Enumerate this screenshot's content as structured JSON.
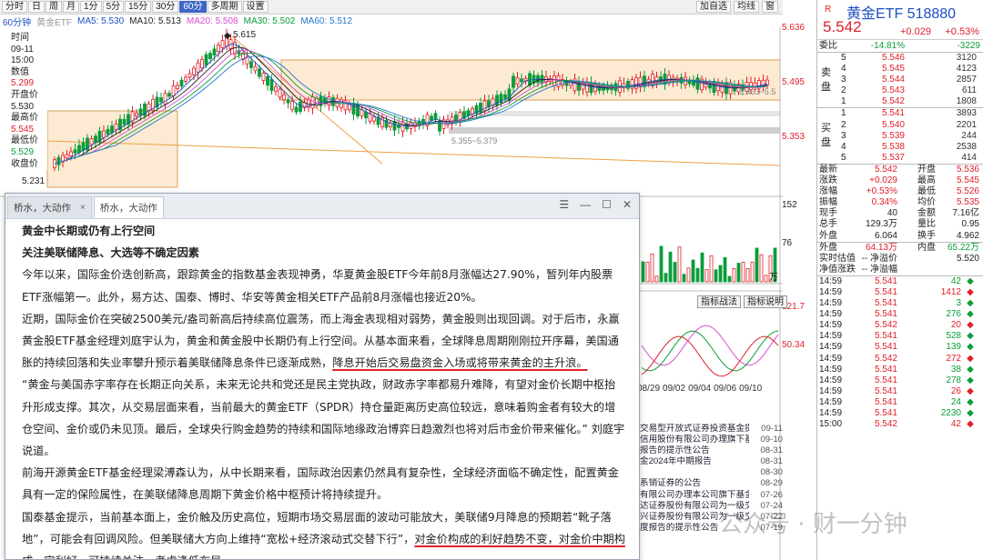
{
  "toolbar": {
    "buttons": [
      "分时",
      "日",
      "周",
      "月",
      "1分",
      "5分",
      "15分",
      "30分",
      "60分",
      "多周期",
      "设置"
    ],
    "active_index": 8,
    "right_buttons": [
      "加自选",
      "均线",
      "窗"
    ]
  },
  "ma_row": {
    "period": "60分钟",
    "name": "黄金ETF",
    "ma5": "MA5: 5.530",
    "ma10": "MA10: 5.513",
    "ma20": "MA20: 5.508",
    "ma30": "MA30: 5.502",
    "ma60": "MA60: 5.512",
    "colors": {
      "ma5": "#1f4fc4",
      "ma10": "#222222",
      "ma20": "#d74fd0",
      "ma30": "#0b9d3a",
      "ma60": "#2277cc"
    }
  },
  "left_panel": {
    "time_label": "时间",
    "date": "09-11",
    "time": "15:00",
    "value_label": "数值",
    "value": "5.299",
    "open_label": "开盘价",
    "open": "5.530",
    "high_label": "最高价",
    "high": "5.545",
    "low_label": "最低价",
    "low": "5.529",
    "close_label": "收盘价"
  },
  "price_labels": {
    "p1": "5.636",
    "p2": "5.495",
    "p3": "5.353",
    "hi_mark": "5.615",
    "lo_mark": "5.231",
    "range_mark": "5.355~5.379",
    "range_mark2": "5.463~5.5"
  },
  "volume_labels": {
    "v1": "152",
    "v2": "76",
    "unit": "万"
  },
  "indicator": {
    "tab1": "指标战法",
    "tab2": "指标说明",
    "v1": "121.7",
    "v2": "50.34"
  },
  "dates": [
    "08/29",
    "09/02",
    "09/04",
    "09/06",
    "09/10"
  ],
  "news_list": [
    {
      "title": "交易型开放式证券投资基金提供主...",
      "date": "09-11"
    },
    {
      "title": "信用股份有限公司办理旗下基金相关销...",
      "date": "09-10"
    },
    {
      "title": "报告的提示性公告",
      "date": "08-31"
    },
    {
      "title": "金2024年中期报告",
      "date": "08-31"
    },
    {
      "title": "",
      "date": "08-30"
    },
    {
      "title": "系销证券的公告",
      "date": "08-29"
    },
    {
      "title": "有限公司办理本公司旗下基金...",
      "date": "07-26"
    },
    {
      "title": "达证券股份有限公司为一级交易商...",
      "date": "07-24"
    },
    {
      "title": "兴证券股份有限公司为一级交易商...",
      "date": "07-22"
    },
    {
      "title": "度报告的提示性公告",
      "date": "07-19"
    }
  ],
  "news": {
    "tabs": [
      "桥水，大动作",
      "桥水，大动作"
    ],
    "heading1": "黄金中长期或仍有上行空间",
    "heading2": "关注美联储降息、大选等不确定因素",
    "p1": "今年以来，国际金价迭创新高，跟踪黄金的指数基金表现神勇，华夏黄金股ETF今年前8月涨幅达27.90%，暂列年内股票ETF涨幅第一。此外，易方达、国泰、博时、华安等黄金相关ETF产品前8月涨幅也接近20%。",
    "p2a": "近期，国际金价在突破2500美元/盎司新高后持续高位震荡，而上海金表现相对弱势，黄金股则出现回调。对于后市，永赢黄金股ETF基金经理刘庭宇认为，黄金和黄金股中长期仍有上行空间。从基本面来看，全球降息周期刚刚拉开序幕，美国通胀的持续回落和失业率攀升预示着美联储降息条件已逐渐成熟，",
    "p2b": "降息开始后交易盘资金入场或将带来黄金的主升浪。",
    "p3": "“黄金与美国赤字率存在长期正向关系，未来无论共和党还是民主党执政，财政赤字率都易升难降，有望对金价长期中枢抬升形成支撑。其次，从交易层面来看，当前最大的黄金ETF（SPDR）持仓量距离历史高位较远，意味着购金者有较大的增仓空间、金价或仍未见顶。最后，全球央行购金趋势的持续和国际地缘政治博弈日趋激烈也将对后市金价带来催化。” 刘庭宇说道。",
    "p4": "前海开源黄金ETF基金经理梁溥森认为，从中长期来看，国际政治因素仍然具有复杂性，全球经济面临不确定性，配置黄金具有一定的保险属性，在美联储降息周期下黄金价格中枢预计将持续提升。",
    "p5a": "国泰基金提示，当前基本面上，金价触及历史高位，短期市场交易层面的波动可能放大，美联储9月降息的预期若“靴子落地”，可能会有回调风险。但美联储大方向上维持“宽松+经济滚动式交替下行”，",
    "p5b": "对金价构成的利好趋势不变，对金价中期构成一定利好，可持续关注、考虑逢低布局。"
  },
  "quote": {
    "R": "R",
    "name": "黄金ETF 518880",
    "price": "5.542",
    "change": "+0.029",
    "pct": "+0.53%",
    "wb_label": "委比",
    "wb": "-14.81%",
    "wc": "-3229",
    "sell_label": "卖盘",
    "buy_label": "买盘",
    "asks": [
      {
        "lv": "5",
        "price": "5.546",
        "vol": "3120"
      },
      {
        "lv": "4",
        "price": "5.545",
        "vol": "4123"
      },
      {
        "lv": "3",
        "price": "5.544",
        "vol": "2857"
      },
      {
        "lv": "2",
        "price": "5.543",
        "vol": "611"
      },
      {
        "lv": "1",
        "price": "5.542",
        "vol": "1808"
      }
    ],
    "bids": [
      {
        "lv": "1",
        "price": "5.541",
        "vol": "3893"
      },
      {
        "lv": "2",
        "price": "5.540",
        "vol": "2201"
      },
      {
        "lv": "3",
        "price": "5.539",
        "vol": "244"
      },
      {
        "lv": "4",
        "price": "5.538",
        "vol": "2538"
      },
      {
        "lv": "5",
        "price": "5.537",
        "vol": "414"
      }
    ],
    "stats": [
      [
        "最新",
        "5.542",
        "开盘",
        "5.536"
      ],
      [
        "涨跌",
        "+0.029",
        "最高",
        "5.545"
      ],
      [
        "涨幅",
        "+0.53%",
        "最低",
        "5.526"
      ],
      [
        "振幅",
        "0.34%",
        "均价",
        "5.535"
      ],
      [
        "现手",
        "40",
        "金额",
        "7.16亿"
      ],
      [
        "总手",
        "129.3万",
        "量比",
        "0.95"
      ],
      [
        "外盘",
        "6.064",
        "换手",
        "4.962"
      ]
    ],
    "outer": [
      "外盘",
      "64.13万",
      "内盘",
      "65.22万"
    ],
    "extra": [
      [
        "实时估值",
        "-- 净溢价",
        "",
        "5.520"
      ],
      [
        "净值涨跌",
        "-- 净溢幅",
        "",
        ""
      ]
    ],
    "ticks": [
      [
        "14:59",
        "5.541",
        "42",
        "◆"
      ],
      [
        "14:59",
        "5.541",
        "1412",
        "◆"
      ],
      [
        "14:59",
        "5.541",
        "3",
        "◆"
      ],
      [
        "14:59",
        "5.541",
        "276",
        "◆"
      ],
      [
        "14:59",
        "5.542",
        "20",
        "◆"
      ],
      [
        "14:59",
        "5.541",
        "528",
        "◆"
      ],
      [
        "14:59",
        "5.541",
        "139",
        "◆"
      ],
      [
        "14:59",
        "5.542",
        "272",
        "◆"
      ],
      [
        "14:59",
        "5.541",
        "38",
        "◆"
      ],
      [
        "14:59",
        "5.541",
        "278",
        "◆"
      ],
      [
        "14:59",
        "5.541",
        "26",
        "◆"
      ],
      [
        "14:59",
        "5.541",
        "24",
        "◆"
      ],
      [
        "14:59",
        "5.541",
        "2230",
        "◆"
      ],
      [
        "15:00",
        "5.542",
        "42",
        "◆"
      ]
    ]
  },
  "watermark": "公众号 · 财一分钟"
}
